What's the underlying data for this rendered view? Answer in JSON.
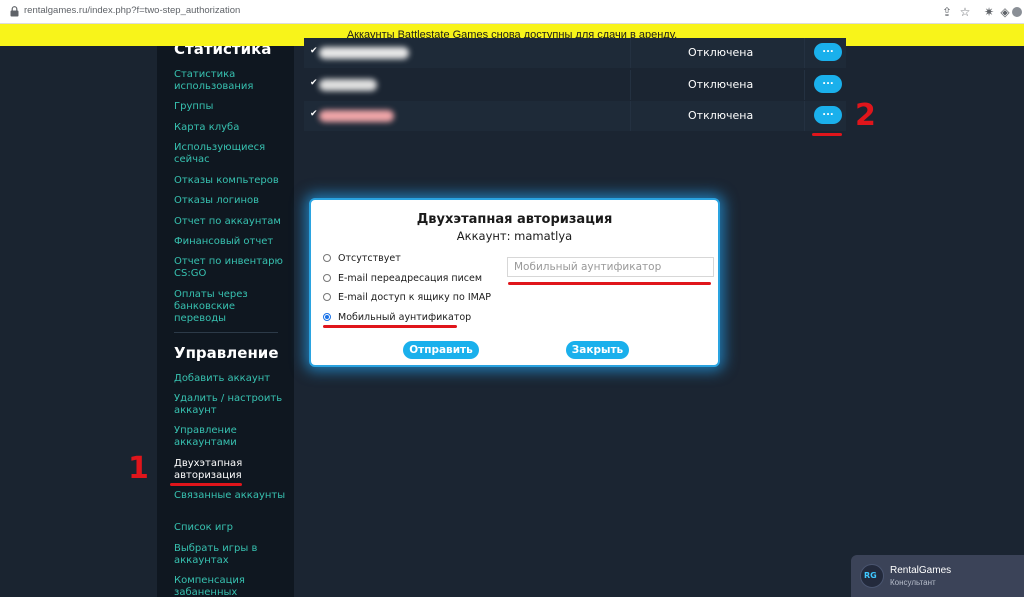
{
  "browser": {
    "url": "rentalgames.ru/index.php?f=two-step_authorization",
    "icons": [
      "share-icon",
      "star-icon",
      "extension-icon",
      "puzzle-icon",
      "profile-icon"
    ]
  },
  "banner": {
    "text": "Аккаунты Battlestate Games снова доступны для сдачи в аренду."
  },
  "sidebar": {
    "stats_heading": "Статистика",
    "stats_items": [
      "Статистика использования",
      "Группы",
      "Карта клуба",
      "Использующиеся сейчас",
      "Отказы компьтеров",
      "Отказы логинов",
      "Отчет по аккаунтам",
      "Финансовый отчет",
      "Отчет по инвентарю CS:GO",
      "Оплаты через банковские переводы"
    ],
    "manage_heading": "Управление",
    "manage_items": [
      "Добавить аккаунт",
      "Удалить / настроить аккаунт",
      "Управление аккаунтами",
      "Двухэтапная авторизация",
      "Связанные аккаунты",
      "Список игр",
      "Выбрать игры в аккаунтах",
      "Компенсация забаненных"
    ],
    "active_item": "Двухэтапная авторизация"
  },
  "table": {
    "rows": [
      {
        "status": "Отключена",
        "action": "..."
      },
      {
        "status": "Отключена",
        "action": "..."
      },
      {
        "status": "Отключена",
        "action": "..."
      }
    ]
  },
  "annotations": {
    "num1": "1",
    "num2": "2",
    "color": "#e0151b"
  },
  "modal": {
    "title": "Двухэтапная авторизация",
    "account_label": "Аккаунт: mamatlya",
    "options": [
      "Отсутствует",
      "E-mail переадресация писем",
      "E-mail доступ к ящику по IMAP",
      "Мобильный аунтификатор"
    ],
    "selected_option": "Мобильный аунтификатор",
    "input_placeholder": "Мобильный аунтификатор",
    "submit_label": "Отправить",
    "close_label": "Закрыть"
  },
  "chat": {
    "logo_text": "RG",
    "name": "RentalGames",
    "role": "Консультант"
  },
  "colors": {
    "accent": "#1ab0ec",
    "link": "#37c1b0",
    "banner": "#f8f41a",
    "background": "#1b2532"
  }
}
